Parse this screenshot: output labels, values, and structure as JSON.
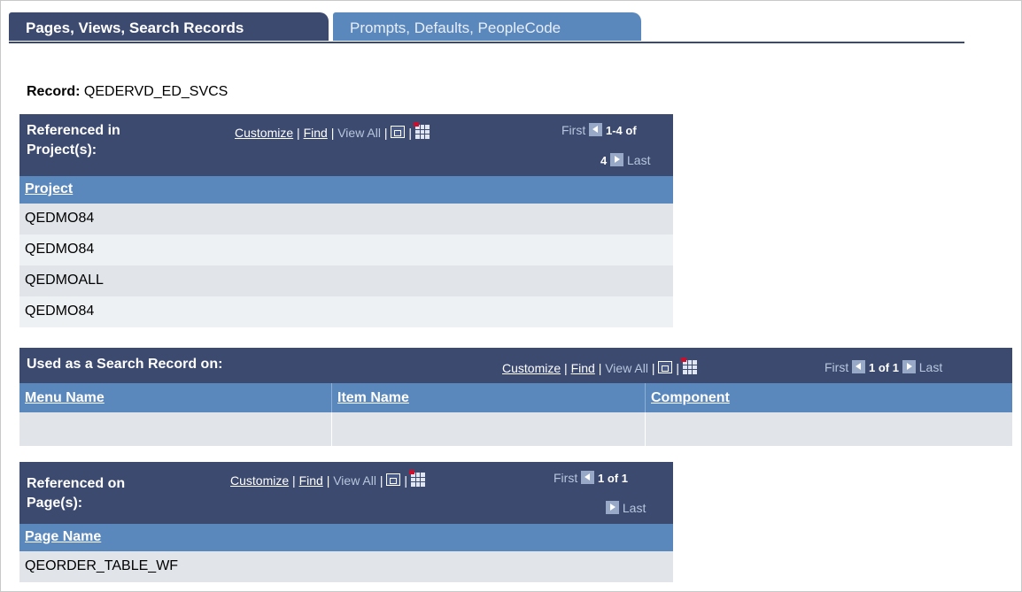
{
  "tabs": [
    {
      "label": "Pages, Views, Search Records",
      "active": true
    },
    {
      "label": "Prompts, Defaults, PeopleCode",
      "active": false
    }
  ],
  "record": {
    "label": "Record:",
    "value": "QEDERVD_ED_SVCS"
  },
  "grid_links": {
    "customize": "Customize",
    "find": "Find",
    "view_all": "View All",
    "sep": "|"
  },
  "projects_grid": {
    "title_line1": "Referenced in",
    "title_line2": "Project(s):",
    "first": "First",
    "count_a": "1-4 of",
    "count_b": "4",
    "last": "Last",
    "column": "Project",
    "rows": [
      "QEDMO84",
      "QEDMO84",
      "QEDMOALL",
      "QEDMO84"
    ]
  },
  "search_grid": {
    "title": "Used as a Search Record on:",
    "first": "First",
    "count": "1 of 1",
    "last": "Last",
    "columns": [
      "Menu Name",
      "Item Name",
      "Component"
    ]
  },
  "pages_grid": {
    "title_line1": "Referenced on",
    "title_line2": "Page(s):",
    "first": "First",
    "count": "1 of 1",
    "last": "Last",
    "column": "Page Name",
    "rows": [
      "QEORDER_TABLE_WF"
    ]
  },
  "icons": {
    "zoom": "zoom-icon",
    "download": "download-grid-icon",
    "prev": "prev-icon",
    "next": "next-icon"
  },
  "colors": {
    "header_dark": "#3c4a70",
    "header_light": "#5a88bd",
    "row_odd": "#e1e5ea",
    "row_even": "#eef1f4"
  }
}
